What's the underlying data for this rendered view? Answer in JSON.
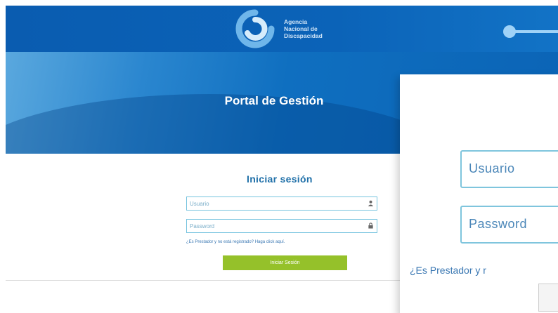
{
  "header": {
    "logo_icon": "agency-swirl-logo-icon",
    "logo_lines": [
      "Agencia",
      "Nacional de",
      "Discapacidad"
    ]
  },
  "hero": {
    "title": "Portal de Gestión"
  },
  "login": {
    "title": "Iniciar sesión",
    "username_placeholder": "Usuario",
    "password_placeholder": "Password",
    "username_icon": "user-icon",
    "password_icon": "lock-icon",
    "register_link": "¿Es Prestador y no está registrado? Haga click aquí.",
    "submit_label": "Iniciar Sesión"
  },
  "zoom": {
    "username_label": "Usuario",
    "password_label": "Password",
    "register_link_partial": "¿Es Prestador y r"
  },
  "colors": {
    "header_blue": "#0b63b8",
    "title_blue": "#1e6fa8",
    "input_border": "#77c4df",
    "button_green": "#95c12a"
  }
}
